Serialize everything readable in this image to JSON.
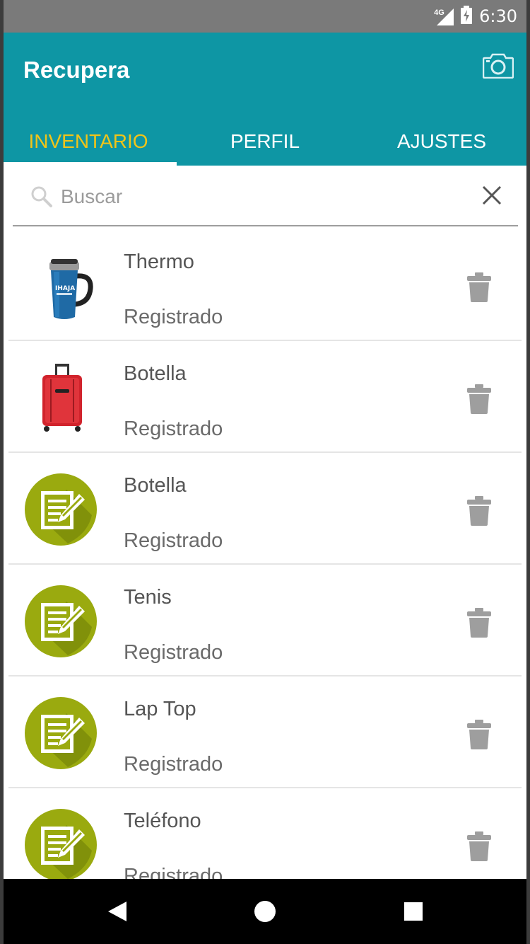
{
  "status_bar": {
    "network": "4G",
    "time": "6:30"
  },
  "app_bar": {
    "title": "Recupera",
    "camera_icon": "camera-icon"
  },
  "tabs": [
    {
      "label": "INVENTARIO",
      "active": true
    },
    {
      "label": "PERFIL",
      "active": false
    },
    {
      "label": "AJUSTES",
      "active": false
    }
  ],
  "search": {
    "placeholder": "Buscar",
    "value": ""
  },
  "items": [
    {
      "title": "Thermo",
      "status": "Registrado",
      "thumbnail": "thermo-mug"
    },
    {
      "title": "Botella",
      "status": "Registrado",
      "thumbnail": "red-suitcase"
    },
    {
      "title": "Botella",
      "status": "Registrado",
      "thumbnail": "note-icon"
    },
    {
      "title": "Tenis",
      "status": "Registrado",
      "thumbnail": "note-icon"
    },
    {
      "title": "Lap Top",
      "status": "Registrado",
      "thumbnail": "note-icon"
    },
    {
      "title": "Teléfono",
      "status": "Registrado",
      "thumbnail": "note-icon"
    }
  ],
  "colors": {
    "primary": "#0e96a4",
    "tab_active": "#f0c419",
    "note_icon": "#9aaa0f",
    "trash": "#9e9e9e"
  }
}
